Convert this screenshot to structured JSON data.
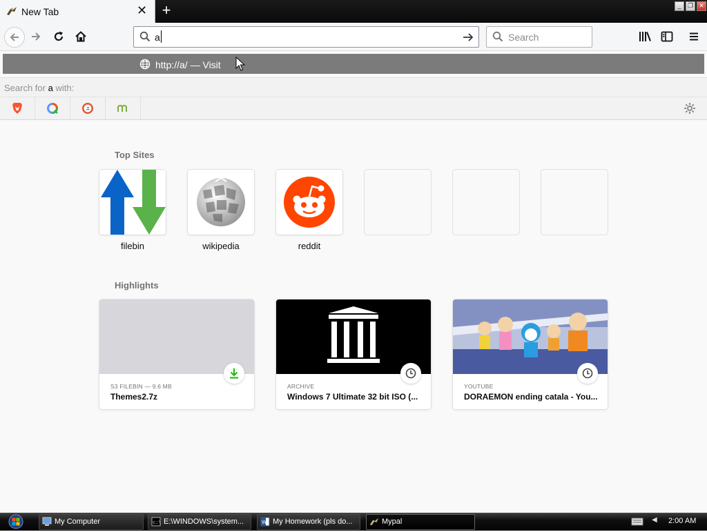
{
  "browser": {
    "tab_title": "New Tab",
    "url_value": "a",
    "search_placeholder": "Search",
    "popup_url": "http://a/",
    "popup_separator": "—",
    "popup_action": "Visit",
    "search_for_prefix": "Search for",
    "search_for_term": "a",
    "search_for_suffix": "with:"
  },
  "engines": [
    "brave-icon",
    "qwant-icon",
    "duckduckgo-icon",
    "mojeek-icon"
  ],
  "top_sites": {
    "title": "Top Sites",
    "items": [
      {
        "label": "filebin",
        "icon": "up-down-arrows-icon"
      },
      {
        "label": "wikipedia",
        "icon": "wikipedia-globe-icon"
      },
      {
        "label": "reddit",
        "icon": "reddit-icon"
      },
      {
        "label": "",
        "icon": ""
      },
      {
        "label": "",
        "icon": ""
      },
      {
        "label": "",
        "icon": ""
      }
    ]
  },
  "highlights": {
    "title": "Highlights",
    "items": [
      {
        "context": "S3 FILEBIN — 9.6 MB",
        "title": "Themes2.7z",
        "badge": "download-icon"
      },
      {
        "context": "ARCHIVE",
        "title": "Windows 7 Ultimate 32 bit ISO (...",
        "badge": "clock-icon"
      },
      {
        "context": "YOUTUBE",
        "title": "DORAEMON ending catala - You...",
        "badge": "clock-icon"
      }
    ]
  },
  "taskbar": {
    "items": [
      {
        "label": "My Computer",
        "icon": "my-computer-icon"
      },
      {
        "label": "E:\\WINDOWS\\system...",
        "icon": "console-icon"
      },
      {
        "label": "My Homework (pls do...",
        "icon": "word-icon"
      },
      {
        "label": "Mypal",
        "icon": "mypal-icon"
      }
    ],
    "clock": "2:00 AM"
  },
  "colors": {
    "accent_green": "#12bc00",
    "reddit": "#ff4500",
    "wiki_up": "#0a64c8",
    "wiki_down": "#5ab24a",
    "popup_bg": "#7b7b7b"
  }
}
